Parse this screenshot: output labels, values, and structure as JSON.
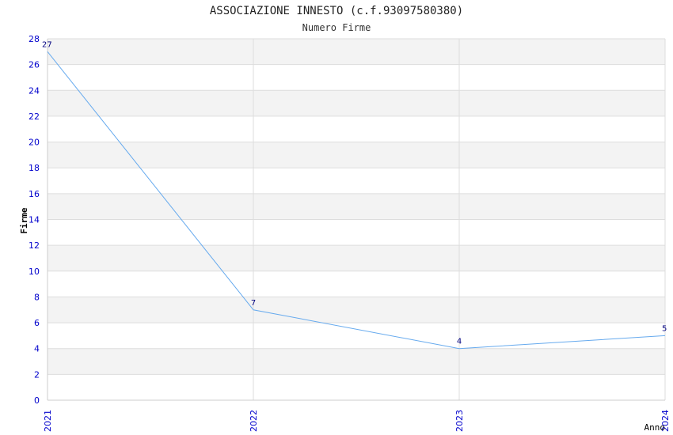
{
  "chart_data": {
    "type": "line",
    "title": "ASSOCIAZIONE INNESTO (c.f.93097580380)",
    "subtitle": "Numero Firme",
    "xlabel": "Anno",
    "ylabel": "Firme",
    "categories": [
      "2021",
      "2022",
      "2023",
      "2024"
    ],
    "series": [
      {
        "values": [
          27,
          7,
          4,
          5
        ]
      }
    ],
    "ylim": [
      0,
      28
    ],
    "yticks": [
      0,
      2,
      4,
      6,
      8,
      10,
      12,
      14,
      16,
      18,
      20,
      22,
      24,
      26,
      28
    ],
    "grid": true,
    "legend": "none",
    "colors": {
      "line": "#66aaee",
      "tick_label": "#0000cc",
      "band": "#f3f3f3",
      "gridline": "#dddddd",
      "data_label": "#000080"
    }
  }
}
